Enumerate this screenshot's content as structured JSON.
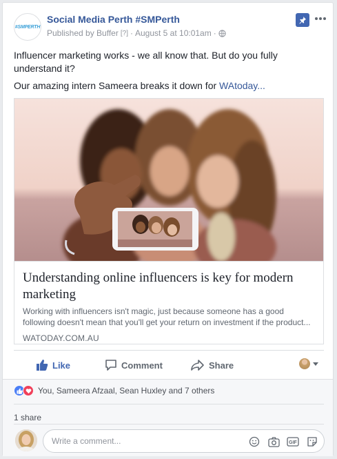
{
  "post": {
    "page_name": "Social Media Perth #SMPerth",
    "page_logo_text": "#SMPERTH",
    "published_by": "Published by Buffer",
    "help_marker": "[?]",
    "date": "August 5 at 10:01am",
    "separator": "·",
    "text_line1": "Influencer marketing works - we all know that. But do you fully understand it?",
    "text_line2_prefix": "Our amazing intern Sameera breaks it down for ",
    "text_line2_link": "WAtoday..."
  },
  "link_preview": {
    "title": "Understanding online influencers is key for modern marketing",
    "description": "Working with influencers isn't magic, just because someone has a good following doesn't mean that you'll get your return on investment if the product...",
    "domain": "WATODAY.COM.AU"
  },
  "actions": {
    "like": "Like",
    "comment": "Comment",
    "share": "Share"
  },
  "reactions": {
    "summary": "You, Sameera Afzaal, Sean Huxley and 7 others",
    "shares": "1 share"
  },
  "composer": {
    "placeholder": "Write a comment..."
  },
  "colors": {
    "brand_blue": "#4267b2",
    "link_blue": "#365899",
    "love_red": "#f0405a"
  },
  "icons": [
    "pin-icon",
    "more-icon",
    "globe-icon",
    "like-icon",
    "comment-icon",
    "share-icon",
    "emoji-icon",
    "camera-icon",
    "gif-icon",
    "sticker-icon"
  ]
}
